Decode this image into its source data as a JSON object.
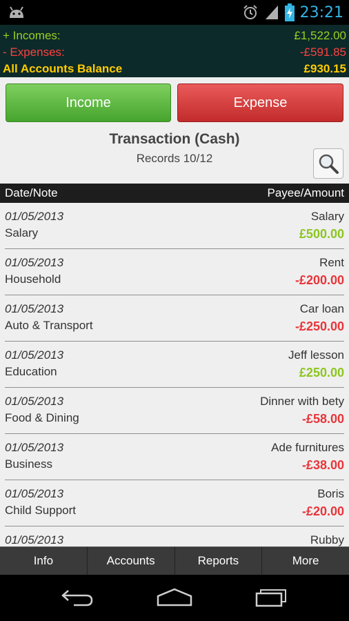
{
  "status": {
    "time": "23:21",
    "icons": [
      "android-icon",
      "alarm-icon",
      "signal-icon",
      "battery-charging-icon"
    ]
  },
  "summary": {
    "incomes_label": "+ Incomes:",
    "incomes_value": "£1,522.00",
    "expenses_label": "- Expenses:",
    "expenses_value": "-£591.85",
    "balance_label": "All Accounts Balance",
    "balance_value": "£930.15"
  },
  "actions": {
    "income_label": "Income",
    "expense_label": "Expense"
  },
  "header": {
    "title": "Transaction (Cash)",
    "records": "Records 10/12"
  },
  "columns": {
    "left": "Date/Note",
    "right": "Payee/Amount"
  },
  "transactions": [
    {
      "date": "01/05/2013",
      "category": "Salary",
      "payee": "Salary",
      "amount": "£500.00",
      "type": "income"
    },
    {
      "date": "01/05/2013",
      "category": "Household",
      "payee": "Rent",
      "amount": "-£200.00",
      "type": "expense"
    },
    {
      "date": "01/05/2013",
      "category": "Auto & Transport",
      "payee": "Car loan",
      "amount": "-£250.00",
      "type": "expense"
    },
    {
      "date": "01/05/2013",
      "category": "Education",
      "payee": "Jeff lesson",
      "amount": "£250.00",
      "type": "income"
    },
    {
      "date": "01/05/2013",
      "category": "Food & Dining",
      "payee": "Dinner with bety",
      "amount": "-£58.00",
      "type": "expense"
    },
    {
      "date": "01/05/2013",
      "category": "Business",
      "payee": "Ade furnitures",
      "amount": "-£38.00",
      "type": "expense"
    },
    {
      "date": "01/05/2013",
      "category": "Child Support",
      "payee": "Boris",
      "amount": "-£20.00",
      "type": "expense"
    },
    {
      "date": "01/05/2013",
      "category": "",
      "payee": "Rubby",
      "amount": "",
      "type": "expense"
    }
  ],
  "tabs": [
    {
      "label": "Info"
    },
    {
      "label": "Accounts"
    },
    {
      "label": "Reports"
    },
    {
      "label": "More"
    }
  ],
  "colors": {
    "income": "#8cc61f",
    "expense": "#e8353a",
    "balance": "#ffcc00",
    "clock": "#33b5e5"
  }
}
